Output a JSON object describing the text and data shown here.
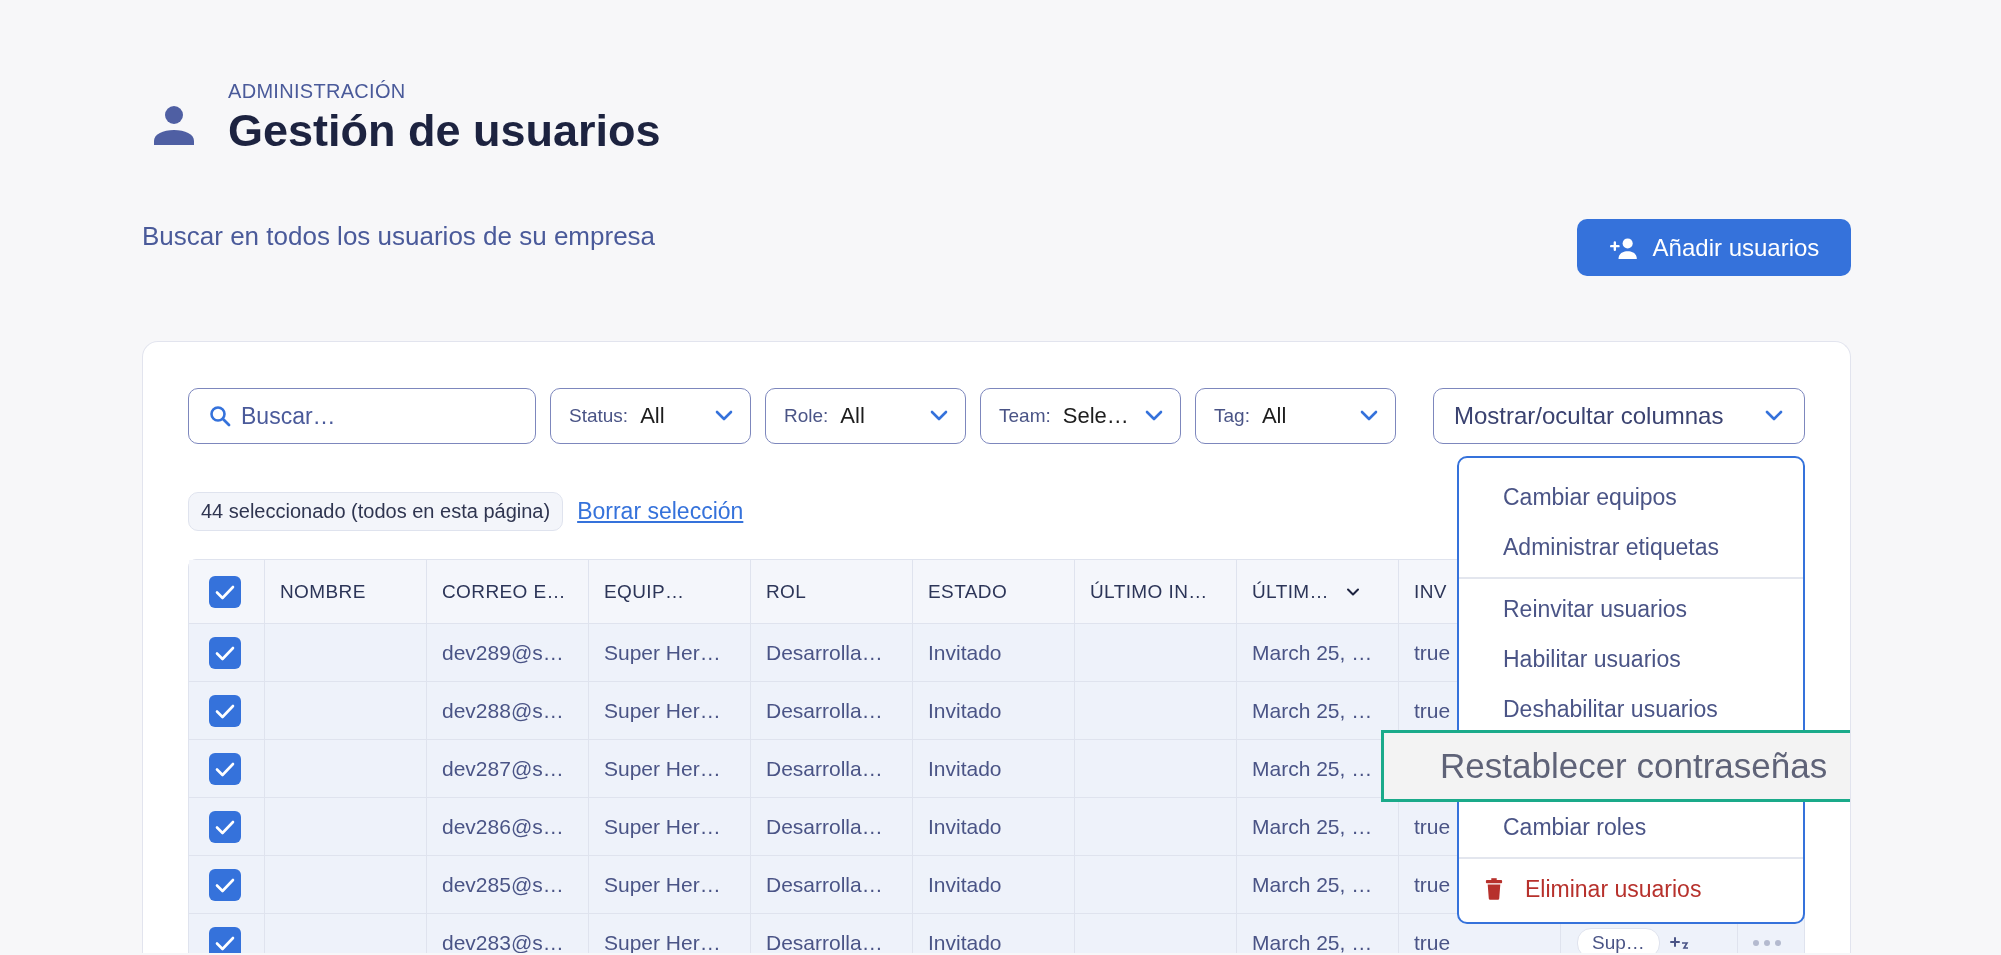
{
  "header": {
    "eyebrow": "ADMINISTRACIÓN",
    "title": "Gestión de usuarios"
  },
  "subtitle": "Buscar en todos los usuarios de su empresa",
  "add_button": {
    "label": "Añadir usuarios"
  },
  "search": {
    "placeholder": "Buscar…"
  },
  "filters": [
    {
      "label": "Status:",
      "value": "All"
    },
    {
      "label": "Role:",
      "value": "All"
    },
    {
      "label": "Team:",
      "value": "Sele…"
    },
    {
      "label": "Tag:",
      "value": "All"
    }
  ],
  "columns_toggle": {
    "label": "Mostrar/ocultar columnas"
  },
  "selection": {
    "summary": "44 seleccionado (todos en esta página)",
    "clear_link": "Borrar selección"
  },
  "table": {
    "all_checked": true,
    "columns": [
      {
        "label": "NOMBRE",
        "sorted": false
      },
      {
        "label": "CORREO E…",
        "sorted": false
      },
      {
        "label": "EQUIP…",
        "sorted": false
      },
      {
        "label": "ROL",
        "sorted": false
      },
      {
        "label": "ESTADO",
        "sorted": false
      },
      {
        "label": "ÚLTIMO IN…",
        "sorted": false
      },
      {
        "label": "ÚLTIM…",
        "sorted": true
      },
      {
        "label": "INV",
        "sorted": false
      }
    ],
    "rows": [
      {
        "checked": true,
        "email": "dev289@s…",
        "team": "Super Her…",
        "role": "Desarrolla…",
        "status": "Invitado",
        "last_update": "March 25, …",
        "invited": "true"
      },
      {
        "checked": true,
        "email": "dev288@s…",
        "team": "Super Her…",
        "role": "Desarrolla…",
        "status": "Invitado",
        "last_update": "March 25, …",
        "invited": "true"
      },
      {
        "checked": true,
        "email": "dev287@s…",
        "team": "Super Her…",
        "role": "Desarrolla…",
        "status": "Invitado",
        "last_update": "March 25, …"
      },
      {
        "checked": true,
        "email": "dev286@s…",
        "team": "Super Her…",
        "role": "Desarrolla…",
        "status": "Invitado",
        "last_update": "March 25, …",
        "invited": "true"
      },
      {
        "checked": true,
        "email": "dev285@s…",
        "team": "Super Her…",
        "role": "Desarrolla…",
        "status": "Invitado",
        "last_update": "March 25, …",
        "invited": "true"
      },
      {
        "checked": true,
        "email": "dev283@s…",
        "team": "Super Her…",
        "role": "Desarrolla…",
        "status": "Invitado",
        "last_update": "March 25, …",
        "invited": "true",
        "tag": "Sup…"
      }
    ]
  },
  "menu": {
    "items": [
      {
        "kind": "item",
        "label": "Cambiar equipos",
        "highlighted": false
      },
      {
        "kind": "item",
        "label": "Administrar etiquetas",
        "highlighted": false
      },
      {
        "kind": "divider"
      },
      {
        "kind": "item",
        "label": "Reinvitar usuarios",
        "highlighted": false
      },
      {
        "kind": "item",
        "label": "Habilitar usuarios",
        "highlighted": false
      },
      {
        "kind": "item",
        "label": "Deshabilitar usuarios",
        "highlighted": false
      },
      {
        "kind": "item",
        "label": "Restablecer contraseñas",
        "highlighted": true
      },
      {
        "kind": "item",
        "label": "Cambiar roles",
        "highlighted": false
      },
      {
        "kind": "divider"
      },
      {
        "kind": "danger",
        "label": "Eliminar usuarios"
      }
    ]
  }
}
